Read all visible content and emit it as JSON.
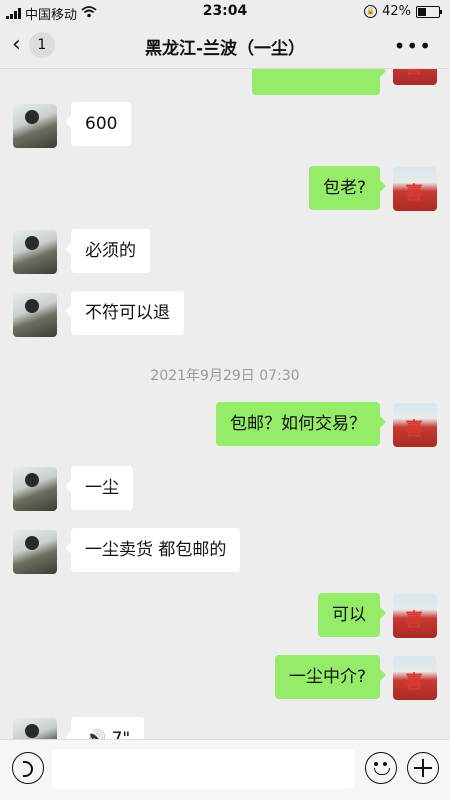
{
  "status_bar": {
    "carrier": "中国移动",
    "time": "23:04",
    "battery": "42%",
    "battery_level": 0.42,
    "icons": [
      "signal-icon",
      "wifi-icon",
      "orientation-lock-icon",
      "battery-icon"
    ]
  },
  "nav": {
    "back_count": "1",
    "title": "黑龙江-兰波（一尘）",
    "more_icon": "more-icon"
  },
  "messages": [
    {
      "side": "other",
      "text": "600"
    },
    {
      "side": "self",
      "text": "包老?"
    },
    {
      "side": "other",
      "text": "必须的"
    },
    {
      "side": "other",
      "text": "不符可以退"
    },
    {
      "side": "timestamp",
      "text": "2021年9月29日 07:30"
    },
    {
      "side": "self",
      "text": "包邮？如何交易？"
    },
    {
      "side": "other",
      "text": "一尘"
    },
    {
      "side": "other",
      "text": "一尘卖货  都包邮的"
    },
    {
      "side": "self",
      "text": "可以"
    },
    {
      "side": "self",
      "text": "一尘中介?"
    },
    {
      "side": "other",
      "text": "🔊 7\""
    }
  ],
  "input_bar": {
    "text_value": "",
    "icons": [
      "voice-icon",
      "emoji-icon",
      "plus-icon"
    ]
  }
}
